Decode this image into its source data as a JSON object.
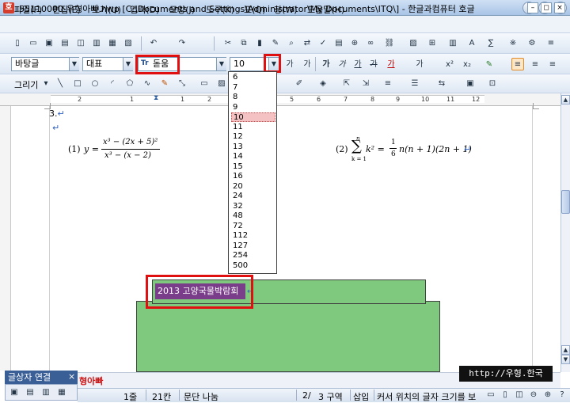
{
  "window": {
    "title": "55110000-우형아빠.hwp [C:\\Documents and Settings\\Administrator\\My Documents\\ITQ\\] - 한글과컴퓨터 호글",
    "app_icon": "호"
  },
  "menu": {
    "items": [
      "파일(F)",
      "편집(E)",
      "보기(U)",
      "입력(D)",
      "모양(J)",
      "도구(K)",
      "표(Q)",
      "창(W)",
      "도움말(H)"
    ]
  },
  "format_toolbar": {
    "style_value": "바탕글",
    "lang_value": "대표",
    "font_value": "돋움",
    "size_value": "10",
    "bold_glyph": "가",
    "italic_glyph": "가",
    "underline_glyph": "가",
    "strike_glyph": "가",
    "color_glyph": "가"
  },
  "draw_toolbar": {
    "label": "그리기"
  },
  "ruler": {
    "numbers": [
      "2",
      "1",
      "1",
      "2",
      "3",
      "4",
      "5",
      "6",
      "7",
      "8",
      "9",
      "10",
      "11",
      "12"
    ]
  },
  "document": {
    "line1": "3.",
    "eq1_label": "(1)",
    "eq1_lhs": "y =",
    "eq1_num": "x³ − (2x + 5)²",
    "eq1_den": "x³ − (x − 2)",
    "eq2_label": "(2)",
    "eq2_sum_top": "n",
    "eq2_sum_bottom": "k = 1",
    "eq2_body": "k² =",
    "eq2_frac_num": "1",
    "eq2_frac_den": "6",
    "eq2_rest": "n(n + 1)(2n + 1)",
    "caption_text": "2013 고양국물박람회"
  },
  "size_dropdown": {
    "options": [
      "6",
      "7",
      "8",
      "9",
      "10",
      "11",
      "12",
      "13",
      "14",
      "15",
      "16",
      "20",
      "24",
      "32",
      "48",
      "72",
      "112",
      "127",
      "254",
      "500"
    ],
    "selected": "10"
  },
  "bottom_panel": {
    "tab_label": "글상자 연결",
    "close": "×"
  },
  "status_bar": {
    "sheet_name": "형아빠",
    "line": "1줄",
    "column": "21칸",
    "section_note": "문단 나눔",
    "page": "2/",
    "section": "3 구역",
    "insert_mode": "삽입",
    "message": "커서 위치의 글자 크기를 보"
  },
  "watermark": "http://우형.한국"
}
